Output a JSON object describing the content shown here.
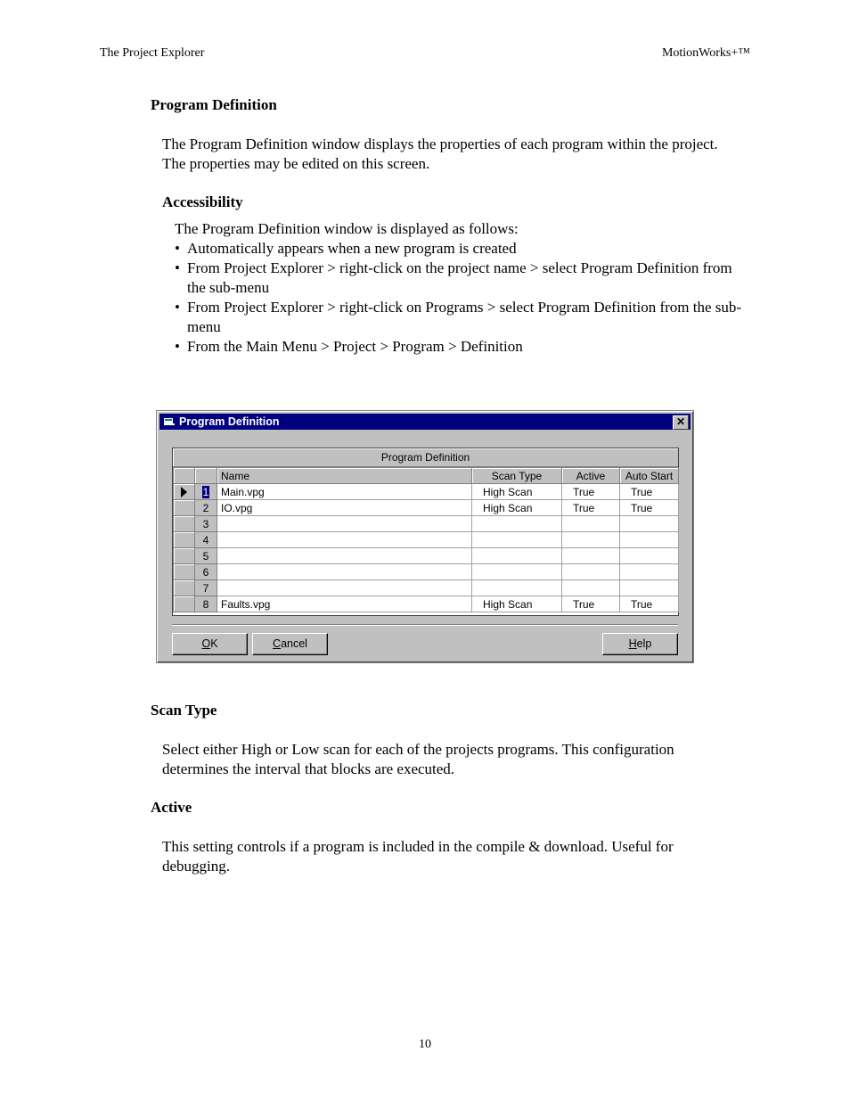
{
  "header": {
    "left": "The Project Explorer",
    "right": "MotionWorks+™"
  },
  "section_title": "Program Definition",
  "intro": "The Program Definition window displays the properties of each program within the project.  The properties may be edited on this screen.",
  "accessibility": {
    "title": "Accessibility",
    "intro": "The Program Definition window is displayed as follows:",
    "bullets": [
      "Automatically appears when a new program is created",
      "From Project Explorer > right-click on the project name > select Program Definition from the sub-menu",
      "From Project Explorer > right-click on Programs > select Program Definition from the sub-menu",
      "From the Main Menu > Project > Program > Definition"
    ]
  },
  "dialog": {
    "title": "Program Definition",
    "close_label": "✕",
    "grid": {
      "caption": "Program Definition",
      "columns": [
        "Name",
        "Scan Type",
        "Active",
        "Auto Start"
      ],
      "rows": [
        {
          "num": "1",
          "name": "Main.vpg",
          "scan_type": "High Scan",
          "active": "True",
          "auto_start": "True",
          "current": true
        },
        {
          "num": "2",
          "name": "IO.vpg",
          "scan_type": "High Scan",
          "active": "True",
          "auto_start": "True"
        },
        {
          "num": "3",
          "name": "",
          "scan_type": "",
          "active": "",
          "auto_start": ""
        },
        {
          "num": "4",
          "name": "",
          "scan_type": "",
          "active": "",
          "auto_start": ""
        },
        {
          "num": "5",
          "name": "",
          "scan_type": "",
          "active": "",
          "auto_start": ""
        },
        {
          "num": "6",
          "name": "",
          "scan_type": "",
          "active": "",
          "auto_start": ""
        },
        {
          "num": "7",
          "name": "",
          "scan_type": "",
          "active": "",
          "auto_start": ""
        },
        {
          "num": "8",
          "name": "Faults.vpg",
          "scan_type": "High Scan",
          "active": "True",
          "auto_start": "True"
        }
      ]
    },
    "buttons": {
      "ok": {
        "mnemonic": "O",
        "rest": "K"
      },
      "cancel": {
        "mnemonic": "C",
        "rest": "ancel"
      },
      "help": {
        "mnemonic": "H",
        "rest": "elp"
      }
    }
  },
  "scan_type": {
    "title": "Scan Type",
    "text": "Select either High or Low scan for each of the projects programs.  This configuration determines the interval that blocks are executed."
  },
  "active": {
    "title": "Active",
    "text": "This setting controls if a program is included in the compile & download.  Useful for debugging."
  },
  "page_number": "10"
}
